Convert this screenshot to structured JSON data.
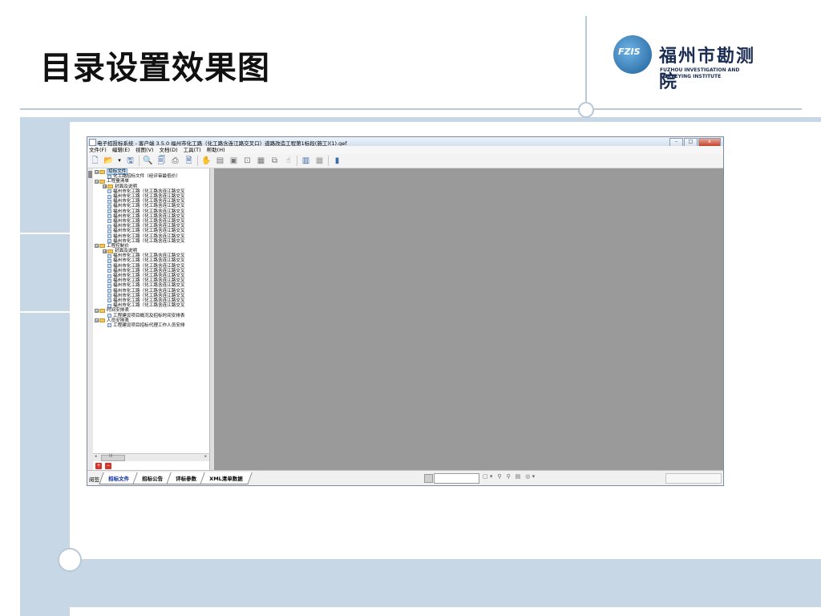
{
  "slide": {
    "title": "目录设置效果图",
    "logo": {
      "emblem_text": "FZIS",
      "name_cn": "福州市勘测院",
      "name_en_line1": "FUZHOU INVESTIGATION AND",
      "name_en_line2": "SURVEYING INSTITUTE"
    }
  },
  "window": {
    "title": "电子招投标系统 - 客户端 3.5.0  福州市化工路（化工路含连江路交叉口）道路改造工程第1标段(施工)(1).gef",
    "buttons": {
      "minimize": "–",
      "maximize": "□",
      "close": "x"
    },
    "menu": [
      "文件(F)",
      "编辑(E)",
      "视图(V)",
      "文档(D)",
      "工具(T)",
      "帮助(H)"
    ],
    "toolbar_icons": [
      "new-doc-icon",
      "open-folder-icon",
      "dropdown-arrow-icon",
      "save-icon",
      "sep",
      "find-doc-icon",
      "preview-icon",
      "print-icon",
      "export-icon",
      "sep",
      "hand-icon",
      "print-alt-icon",
      "print-setup-icon",
      "zoom-icon",
      "fit-page-icon",
      "copy-icon",
      "select-icon",
      "sep",
      "layout-icon",
      "grid-icon",
      "sep",
      "exit-icon"
    ]
  },
  "tree": {
    "nodes": [
      {
        "level": 0,
        "type": "folder",
        "exp": "⊟",
        "label": "招标文件",
        "selected": true
      },
      {
        "level": 1,
        "type": "doc",
        "exp": "",
        "label": "化工路招标文件（经评审最低价）"
      },
      {
        "level": 0,
        "type": "folder",
        "exp": "⊟",
        "label": "工程量清单"
      },
      {
        "level": 1,
        "type": "folder",
        "exp": "⊞",
        "label": "封面及说明"
      },
      {
        "level": 1,
        "type": "doc",
        "exp": "",
        "label": "福州市化工路（化工路含连江路交叉"
      },
      {
        "level": 1,
        "type": "doc",
        "exp": "",
        "label": "福州市化工路（化工路含连江路交叉"
      },
      {
        "level": 1,
        "type": "doc",
        "exp": "",
        "label": "福州市化工路（化工路含连江路交叉"
      },
      {
        "level": 1,
        "type": "doc",
        "exp": "",
        "label": "福州市化工路（化工路含连江路交叉"
      },
      {
        "level": 1,
        "type": "doc",
        "exp": "",
        "label": "福州市化工路（化工路含连江路交叉"
      },
      {
        "level": 1,
        "type": "doc",
        "exp": "",
        "label": "福州市化工路（化工路含连江路交叉"
      },
      {
        "level": 1,
        "type": "doc",
        "exp": "",
        "label": "福州市化工路（化工路含连江路交叉"
      },
      {
        "level": 1,
        "type": "doc",
        "exp": "",
        "label": "福州市化工路（化工路含连江路交叉"
      },
      {
        "level": 1,
        "type": "doc",
        "exp": "",
        "label": "福州市化工路（化工路含连江路交叉"
      },
      {
        "level": 1,
        "type": "doc",
        "exp": "",
        "label": "福州市化工路（化工路含连江路交叉"
      },
      {
        "level": 1,
        "type": "doc",
        "exp": "",
        "label": "福州市化工路（化工路含连江路交叉"
      },
      {
        "level": 0,
        "type": "folder",
        "exp": "⊟",
        "label": "工程控制价"
      },
      {
        "level": 1,
        "type": "folder",
        "exp": "⊞",
        "label": "封面及说明"
      },
      {
        "level": 1,
        "type": "doc",
        "exp": "",
        "label": "福州市化工路（化工路含连江路交叉"
      },
      {
        "level": 1,
        "type": "doc",
        "exp": "",
        "label": "福州市化工路（化工路含连江路交叉"
      },
      {
        "level": 1,
        "type": "doc",
        "exp": "",
        "label": "福州市化工路（化工路含连江路交叉"
      },
      {
        "level": 1,
        "type": "doc",
        "exp": "",
        "label": "福州市化工路（化工路含连江路交叉"
      },
      {
        "level": 1,
        "type": "doc",
        "exp": "",
        "label": "福州市化工路（化工路含连江路交叉"
      },
      {
        "level": 1,
        "type": "doc",
        "exp": "",
        "label": "福州市化工路（化工路含连江路交叉"
      },
      {
        "level": 1,
        "type": "doc",
        "exp": "",
        "label": "福州市化工路（化工路含连江路交叉"
      },
      {
        "level": 1,
        "type": "doc",
        "exp": "",
        "label": "福州市化工路（化工路含连江路交叉"
      },
      {
        "level": 1,
        "type": "doc",
        "exp": "",
        "label": "福州市化工路（化工路含连江路交叉"
      },
      {
        "level": 1,
        "type": "doc",
        "exp": "",
        "label": "福州市化工路（化工路含连江路交叉"
      },
      {
        "level": 1,
        "type": "doc",
        "exp": "",
        "label": "福州市化工路（化工路含连江路交叉"
      },
      {
        "level": 0,
        "type": "folder",
        "exp": "⊟",
        "label": "时间安排表"
      },
      {
        "level": 1,
        "type": "doc",
        "exp": "",
        "label": "工程建设项目概况及招标时间安排表"
      },
      {
        "level": 0,
        "type": "folder",
        "exp": "⊟",
        "label": "人员安排表"
      },
      {
        "level": 1,
        "type": "doc",
        "exp": "",
        "label": "工程建设项目招标代理工作人员安排"
      }
    ],
    "scroll_left": "◂",
    "scroll_mid": "III",
    "scroll_right": "▸"
  },
  "bottom": {
    "tab_prefix": "阅签",
    "tabs": [
      "招标文件",
      "招标公告",
      "评标参数",
      "XML清单数据"
    ],
    "active_tab": 0,
    "status_tools": [
      "▢ ▾",
      "⚲",
      "⚲",
      "▤",
      "◎ ▾"
    ]
  }
}
